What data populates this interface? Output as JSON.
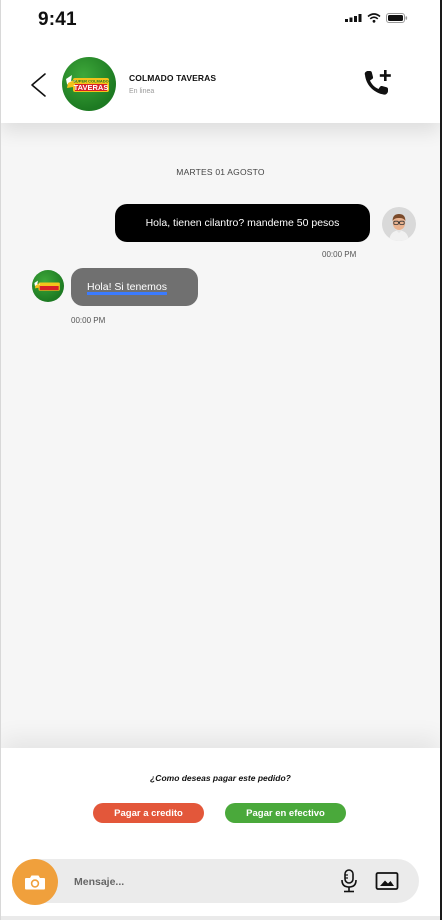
{
  "status_bar": {
    "time": "9:41"
  },
  "header": {
    "contact_name": "COLMADO TAVERAS",
    "contact_status": "En linea",
    "logo_text_top": "SUPER COLMADO",
    "logo_text_main": "TAVERAS"
  },
  "chat": {
    "date_separator": "MARTES 01 AGOSTO",
    "messages": [
      {
        "direction": "out",
        "text": "Hola, tienen cilantro? mandeme 50 pesos",
        "time": "00:00 PM"
      },
      {
        "direction": "in",
        "text": "Hola! Si tenemos",
        "time": "00:00 PM"
      }
    ]
  },
  "payment": {
    "question": "¿Como deseas pagar este pedido?",
    "credit_label": "Pagar a credito",
    "cash_label": "Pagar en efectivo"
  },
  "composer": {
    "placeholder": "Mensaje..."
  },
  "colors": {
    "credit": "#e3573a",
    "cash": "#4aa93b",
    "camera": "#f0a03c",
    "outgoing_bubble": "#000000",
    "incoming_bubble": "#707070"
  },
  "icons": [
    "back-chevron-icon",
    "phone-add-icon",
    "camera-icon",
    "microphone-icon",
    "image-icon",
    "signal-icon",
    "wifi-icon",
    "battery-icon"
  ]
}
